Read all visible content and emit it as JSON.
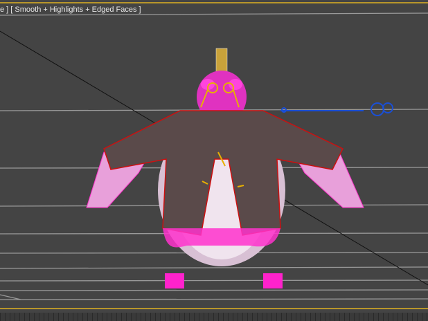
{
  "viewport": {
    "label": "e ] [ Smooth + Highlights + Edged Faces ]",
    "colors": {
      "background": "#444444",
      "grid": "#9a9a9a",
      "border": "#b8962a",
      "selection": "#ff22cc",
      "wire": "#cc1010",
      "helper": "#1a4fd6",
      "accessory": "#e8b000"
    }
  }
}
